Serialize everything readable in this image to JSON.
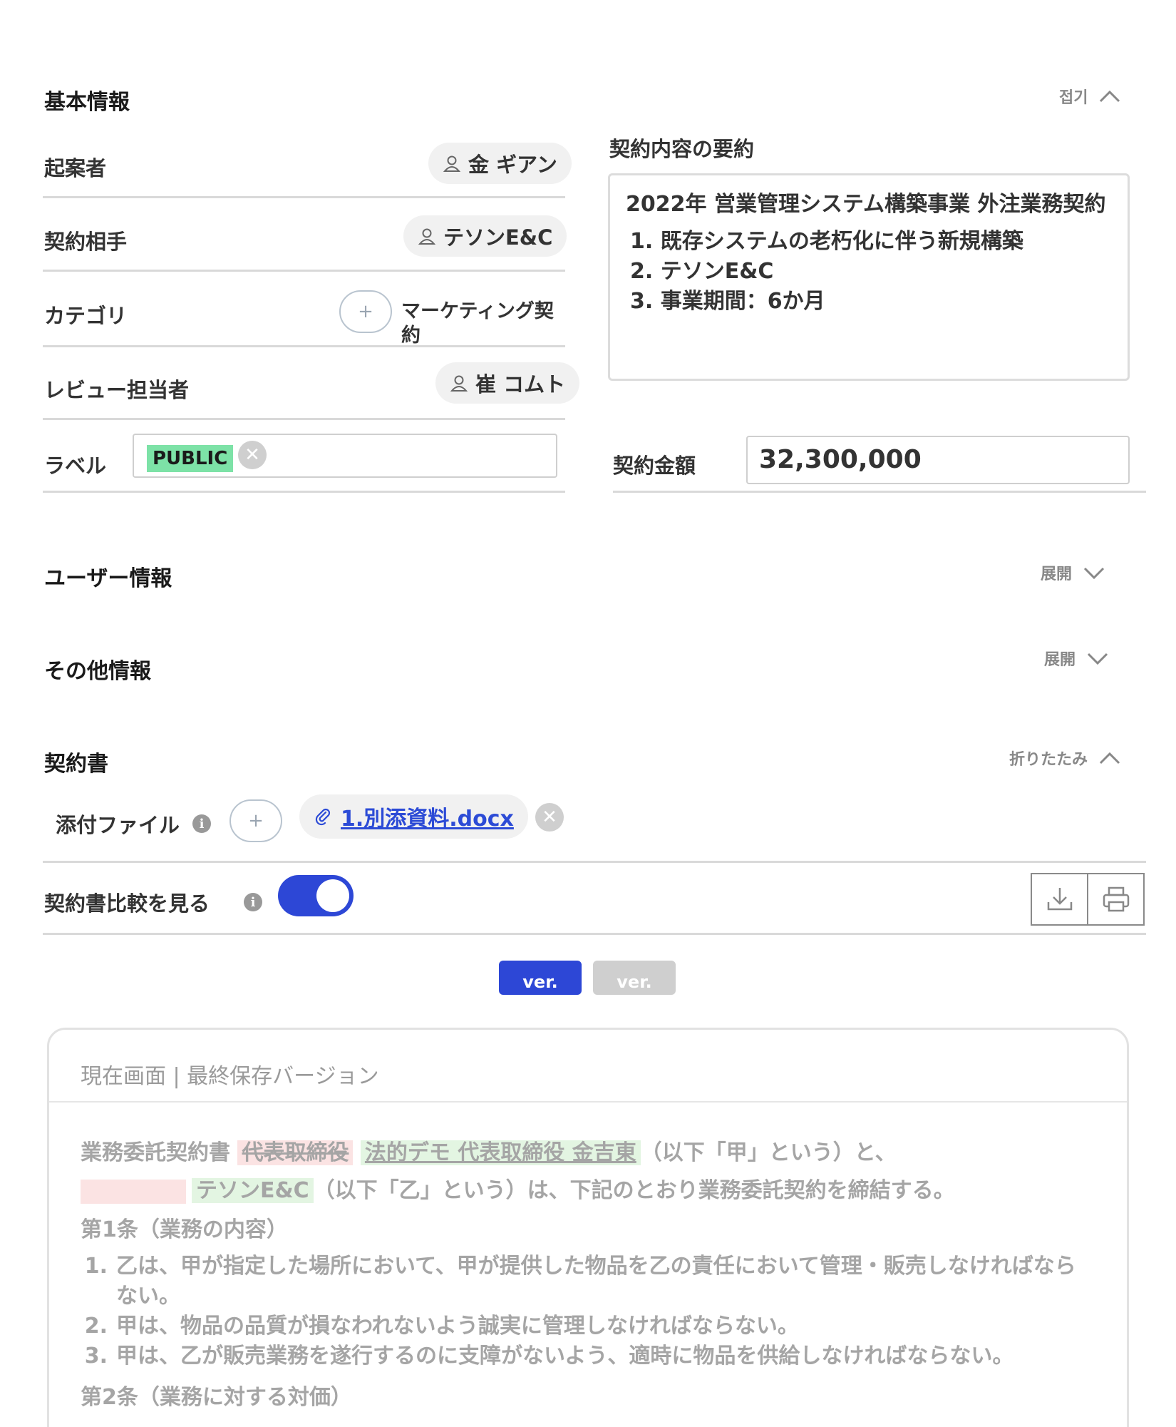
{
  "basic": {
    "title": "基本情報",
    "collapse_label": "접기",
    "rows": {
      "drafter_label": "起案者",
      "drafter_value": "金 ギアン",
      "partner_label": "契約相手",
      "partner_value": "テソンE&C",
      "category_label": "カテゴリ",
      "category_value": "マーケティング契約",
      "reviewer_label": "レビュー担当者",
      "reviewer_value": "崔 コムト",
      "label_label": "ラベル",
      "label_tag": "PUBLIC"
    },
    "summary": {
      "heading": "契約内容の要約",
      "title": "2022年 営業管理システム構築事業 外注業務契約",
      "items": [
        "1. 既存システムの老朽化に伴う新規構築",
        "2. テソンE&C",
        "3. 事業期間：6か月"
      ]
    },
    "amount": {
      "label": "契約金額",
      "value": "32,300,000"
    }
  },
  "user_info": {
    "title": "ユーザー情報",
    "expand_label": "展開"
  },
  "other_info": {
    "title": "その他情報",
    "expand_label": "展開"
  },
  "contract": {
    "title": "契約書",
    "collapse_label": "折りたたみ",
    "attach_label": "添付ファイル",
    "attach_file": "1.別添資料.docx",
    "compare_label": "契約書比較を見る",
    "ver_active": "ver.",
    "ver_inactive": "ver."
  },
  "doc": {
    "header": "現在画面 | 最終保存バージョン",
    "p1_a": "業務委託契約書",
    "p1_del": "代表取締役",
    "p1_ins": "法的デモ 代表取締役 金吉東",
    "p1_b": "（以下「甲」という）と、",
    "p2_ins": "テソンE&C",
    "p2_b": "（以下「乙」という）は、下記のとおり業務委託契約を締結する。",
    "art1": "第1条（業務の内容）",
    "items": [
      {
        "num": "1.",
        "text": "乙は、甲が指定した場所において、甲が提供した物品を乙の責任において管理・販売しなければならない。"
      },
      {
        "num": "2.",
        "text": "甲は、物品の品質が損なわれないよう誠実に管理しなければならない。"
      },
      {
        "num": "3.",
        "text": "甲は、乙が販売業務を遂行するのに支障がないよう、適時に物品を供給しなければならない。"
      }
    ],
    "art2": "第2条（業務に対する対価）"
  },
  "colors": {
    "accent": "#2d47d6",
    "tag_green": "#7de2a7",
    "link": "#2c4bd6",
    "del_bg": "#fbe3e3",
    "ins_bg": "#e3f5e2"
  }
}
